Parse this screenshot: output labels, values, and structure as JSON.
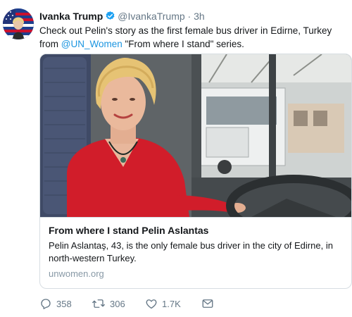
{
  "tweet": {
    "author_name": "Ivanka Trump",
    "handle": "@IvankaTrump",
    "separator": "·",
    "time": "3h",
    "text_before": "Check out Pelin's story as the first female bus driver in Edirne, Turkey from ",
    "mention": "@UN_Women",
    "text_after": " \"From where I stand\" series."
  },
  "card": {
    "title": "From where I stand Pelin Aslantas",
    "description": "Pelin Aslantaş, 43, is the only female bus driver in the city of Edirne, in north-western Turkey.",
    "domain": "unwomen.org"
  },
  "actions": {
    "reply_count": "358",
    "retweet_count": "306",
    "like_count": "1.7K"
  },
  "colors": {
    "link": "#1b95e0",
    "secondary_text": "#657786",
    "verified": "#1da1f2"
  },
  "icons": [
    "verified-badge-icon",
    "reply-icon",
    "retweet-icon",
    "like-icon",
    "direct-message-icon"
  ]
}
